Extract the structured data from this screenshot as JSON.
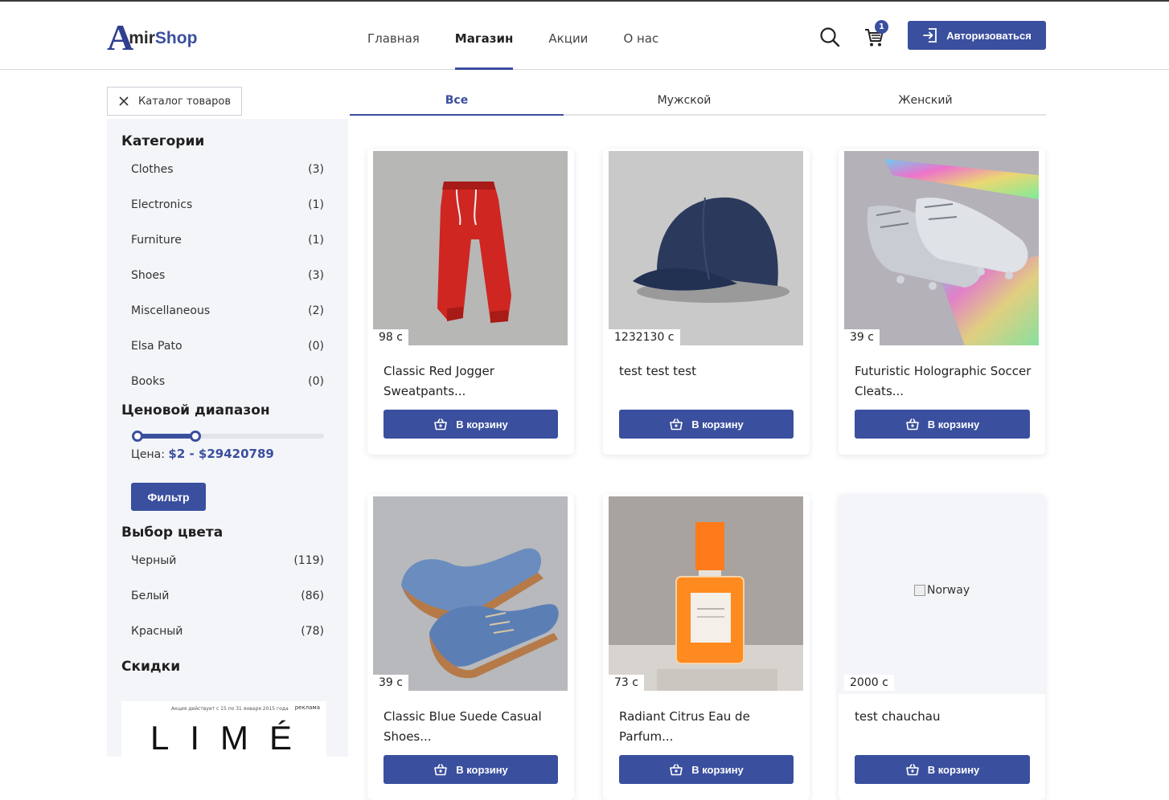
{
  "header": {
    "logo": {
      "letter": "A",
      "mir": "mir",
      "shop": "Shop"
    },
    "nav": [
      {
        "label": "Главная",
        "active": false
      },
      {
        "label": "Магазин",
        "active": true
      },
      {
        "label": "Акции",
        "active": false
      },
      {
        "label": "О нас",
        "active": false
      }
    ],
    "cart_count": "1",
    "login_label": "Авторизоваться",
    "icons": [
      "search-icon",
      "cart-icon",
      "login-icon"
    ]
  },
  "catalog_button": "Каталог товаров",
  "sidebar": {
    "categories_title": "Категории",
    "categories": [
      {
        "label": "Clothes",
        "count": "(3)"
      },
      {
        "label": "Electronics",
        "count": "(1)"
      },
      {
        "label": "Furniture",
        "count": "(1)"
      },
      {
        "label": "Shoes",
        "count": "(3)"
      },
      {
        "label": "Miscellaneous",
        "count": "(2)"
      },
      {
        "label": "Elsa Pato",
        "count": "(0)"
      },
      {
        "label": "Books",
        "count": "(0)"
      }
    ],
    "price_title": "Ценовой диапазон",
    "price_label": "Цена:",
    "price_value": "$2 - $29420789",
    "filter_label": "Фильтр",
    "color_title": "Выбор цвета",
    "colors": [
      {
        "label": "Черный",
        "count": "(119)"
      },
      {
        "label": "Белый",
        "count": "(86)"
      },
      {
        "label": "Красный",
        "count": "(78)"
      }
    ],
    "discounts_title": "Скидки",
    "ad": {
      "small_text": "Акция действует с 15 по 31 января 2015 года",
      "tag": "реклама",
      "brand": "LIMÉ"
    }
  },
  "tabs": [
    {
      "label": "Все",
      "active": true
    },
    {
      "label": "Мужской",
      "active": false
    },
    {
      "label": "Женский",
      "active": false
    }
  ],
  "products": [
    {
      "name": "Classic Red Jogger Sweatpants...",
      "price": "98 с",
      "image": "red-sweatpants"
    },
    {
      "name": "test test test",
      "price": "1232130 с",
      "image": "navy-cap"
    },
    {
      "name": "Futuristic Holographic Soccer Cleats...",
      "price": "39 с",
      "image": "holographic-cleats"
    },
    {
      "name": "Classic Blue Suede Casual Shoes...",
      "price": "39 с",
      "image": "blue-suede-shoes"
    },
    {
      "name": "Radiant Citrus Eau de Parfum...",
      "price": "73 с",
      "image": "orange-perfume"
    },
    {
      "name": "test chauchau",
      "price": "2000 с",
      "image_alt": "Norway"
    }
  ],
  "cart_button_label": "В корзину",
  "colors": {
    "accent": "#3a4f9e",
    "sidebar_bg": "#f4f5f9"
  }
}
